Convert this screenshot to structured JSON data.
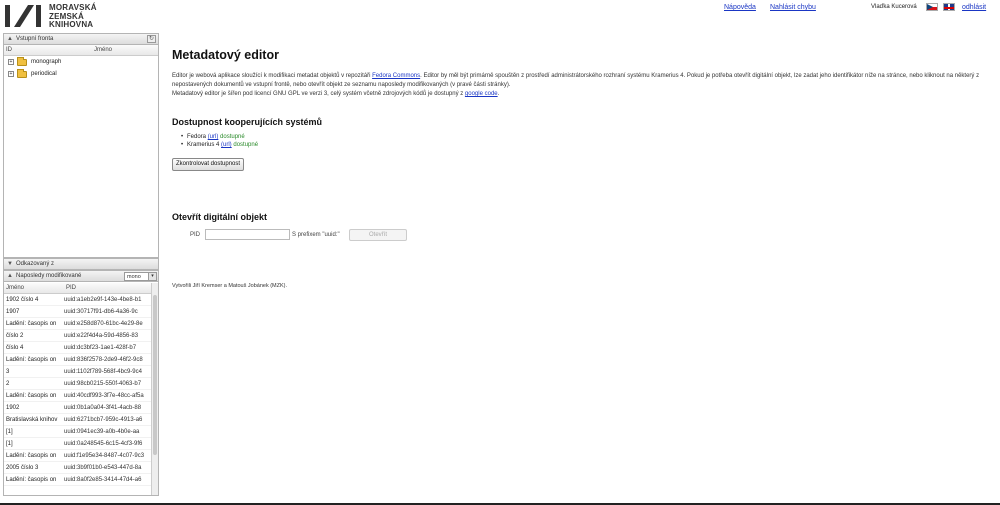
{
  "header": {
    "logo_lines": [
      "MORAVSKÁ",
      "ZEMSKÁ",
      "KNIHOVNA"
    ],
    "links": {
      "help": "Nápověda",
      "bug": "Nahlásit chybu",
      "logout": "odhlásit"
    },
    "user_name": "Vlaďka Kucerová",
    "languages": [
      "cs",
      "en"
    ]
  },
  "panels": {
    "input_queue": {
      "title": "Vstupní fronta",
      "columns": [
        "ID",
        "Jméno"
      ],
      "items": [
        {
          "label": "monograph"
        },
        {
          "label": "periodical"
        }
      ]
    },
    "related": {
      "title": "Odkazovaný z"
    },
    "recent": {
      "title": "Naposledy modifikované",
      "filter_value": "mono",
      "columns": [
        "Jméno",
        "PID"
      ],
      "rows": [
        {
          "name": "1902 číslo 4",
          "pid": "uuid:a1eb2e9f-143e-4be8-b1"
        },
        {
          "name": "1907",
          "pid": "uuid:30717f91-db6-4a36-9c"
        },
        {
          "name": "Ladění: časopis on",
          "pid": "uuid:e258d870-61bc-4e29-8e"
        },
        {
          "name": "číslo 2",
          "pid": "uuid:e22f4d4a-59d-4856-83"
        },
        {
          "name": "číslo 4",
          "pid": "uuid:dc3bf23-1ae1-428f-b7"
        },
        {
          "name": "Ladění: časopis on",
          "pid": "uuid:836f2578-2de9-46f2-9c8"
        },
        {
          "name": "3",
          "pid": "uuid:1102f789-568f-4bc9-9c4"
        },
        {
          "name": "2",
          "pid": "uuid:98cb0215-550f-4063-b7"
        },
        {
          "name": "Ladění: časopis on",
          "pid": "uuid:40cdf993-3f7e-48cc-af5a"
        },
        {
          "name": "1902",
          "pid": "uuid:0b1a0a04-3f41-4acb-88"
        },
        {
          "name": "Bratislavská knihov",
          "pid": "uuid:6271bcb7-959c-4913-a6"
        },
        {
          "name": "[1]",
          "pid": "uuid:0941ec39-a0b-4b0e-aa"
        },
        {
          "name": "[1]",
          "pid": "uuid:0a248545-6c15-4cf3-9f6"
        },
        {
          "name": "Ladění: časopis on",
          "pid": "uuid:f1e95e34-8487-4c07-9c3"
        },
        {
          "name": "2005 číslo 3",
          "pid": "uuid:3b9f01b0-e543-447d-8a"
        },
        {
          "name": "Ladění: časopis on",
          "pid": "uuid:8a0f2e85-3414-47d4-a6"
        }
      ]
    }
  },
  "main": {
    "title": "Metadatový editor",
    "description": {
      "p1_before": "Editor je webová aplikace sloužící k modifikaci metadat objektů v repozitáři ",
      "p1_link": "Fedora Commons",
      "p1_after": ". Editor by měl být primárně spouštěn z prostředí administrátorského rozhraní systému Kramerius 4. Pokud je potřeba otevřít digitální objekt, lze zadat jeho identifikátor níže na stránce, nebo kliknout na některý z nepostavených dokumentů ve vstupní frontě, nebo otevřít objekt ze seznamu naposledy modifikovaných (v pravé části stránky).",
      "p2_before": "Metadatový editor je šířen pod licencí GNU GPL ve verzi 3, celý systém včetně zdrojových kódů je dostupný z ",
      "p2_link": "google code",
      "p2_after": "."
    },
    "systems": {
      "title": "Dostupnost kooperujících systémů",
      "items": [
        {
          "name": "Fedora",
          "url": "(url)",
          "status": "dostupné"
        },
        {
          "name": "Kramerius 4",
          "url": "(url)",
          "status": "dostupné"
        }
      ],
      "check_button": "Zkontrolovat dostupnost"
    },
    "open": {
      "title": "Otevřít digitální objekt",
      "pid_label": "PID",
      "pid_suffix": "S prefixem \"uuid:\"",
      "open_button": "Otevřít"
    },
    "authors": "Vytvořili Jiří Kremser a Matouš Jobánek (MZK)."
  }
}
